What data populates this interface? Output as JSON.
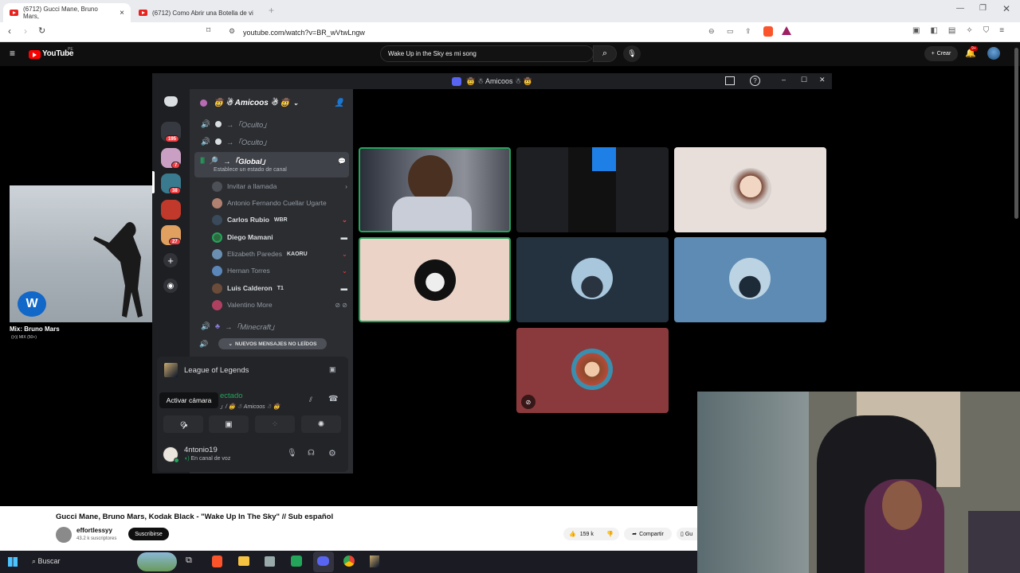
{
  "browser": {
    "tabs": [
      {
        "title": "(6712) Gucci Mane, Bruno Mars, "
      },
      {
        "title": "(6712) Como Abrir una Botella de vi"
      }
    ],
    "url": "youtube.com/watch?v=BR_wVtwLngw"
  },
  "youtube": {
    "logo": "YouTube",
    "region": "PE",
    "search_value": "Wake Up in the Sky es mi song",
    "create_label": "Crear",
    "notif_count": "9+",
    "mix_title": "Mix: Bruno Mars",
    "mix_sub": "MIX (50+)",
    "video_title": "Gucci Mane, Bruno Mars, Kodak Black - \"Wake Up In The Sky\" // Sub español",
    "channel": "effortlessyy",
    "subscribers": "43.2 k suscriptores",
    "subscribe_label": "Suscribirse",
    "likes": "159 k",
    "share_label": "Compartir",
    "save_label": "Gu"
  },
  "discord": {
    "title": "🤠 ☃ Amicoos ☃ 🤠",
    "server_name": "🤠 ☃ Amicoos ☃ 🤠",
    "badges": [
      "195",
      "7",
      "38",
      "27"
    ],
    "channels": [
      {
        "name": "→「Oculto」"
      },
      {
        "name": "→「Oculto」"
      },
      {
        "name": "→「Global」"
      }
    ],
    "channel_status": "Establece un estado de canal",
    "invite_label": "Invitar a llamada",
    "members": [
      {
        "name": "Antonio Fernando Cuellar Ugarte",
        "tag": ""
      },
      {
        "name": "Carlos Rubio",
        "tag": "WBR"
      },
      {
        "name": "Diego Mamani",
        "tag": ""
      },
      {
        "name": "Elizabeth Paredes",
        "tag": "KAORU"
      },
      {
        "name": "Hernan Torres",
        "tag": ""
      },
      {
        "name": "Luis Calderon",
        "tag": "T1"
      },
      {
        "name": "Valentino More",
        "tag": ""
      }
    ],
    "channel_minecraft": "→「Minecraft」",
    "unread_label": "NUEVOS MENSAJES NO LEÍDOS",
    "activity": "League of Legends",
    "tooltip": "Activar cámara",
    "voice_status": "ectado",
    "voice_sub": "」/ 🤠 ☃ Amicoos ☃ 🤠",
    "user_name": "4ntonio19",
    "user_status": "En canal de voz"
  },
  "taskbar": {
    "search_placeholder": "Buscar"
  }
}
